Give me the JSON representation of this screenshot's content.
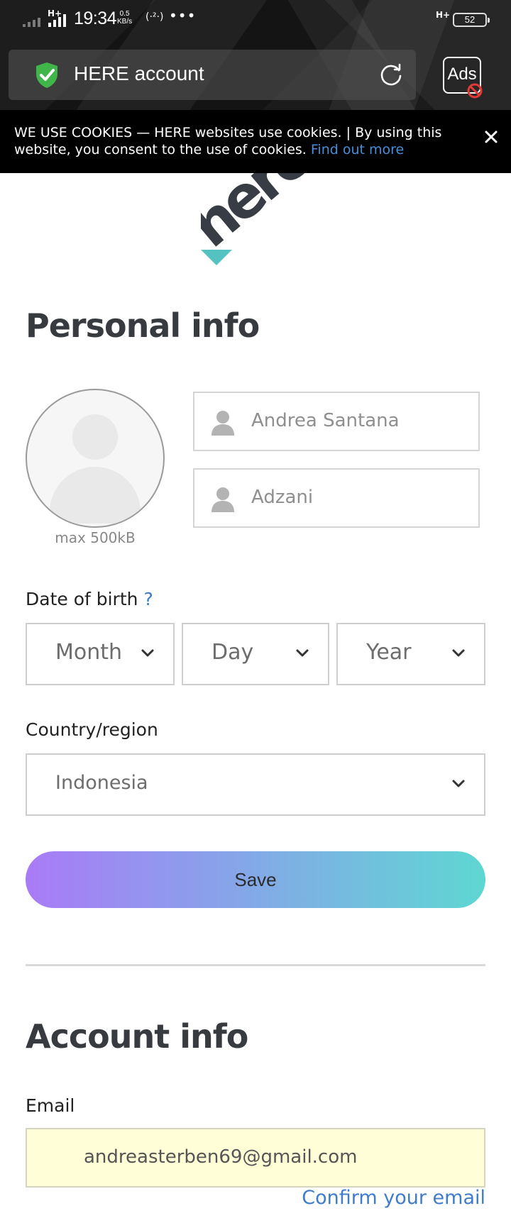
{
  "status_bar": {
    "network_left": "H+",
    "time": "19:34",
    "speed_value": "0.5",
    "speed_unit": "KB/s",
    "hotspot": "(·²·)",
    "more": "•••",
    "network_right": "H+",
    "battery": "52"
  },
  "browser": {
    "url_title": "HERE account",
    "ads_label": "Ads"
  },
  "cookie_banner": {
    "text": "WE USE COOKIES — HERE websites use cookies. | By using this website, you consent to the use of cookies.",
    "link": "Find out more"
  },
  "logo": {
    "text": "here"
  },
  "personal_info": {
    "title": "Personal info",
    "avatar_note": "max 500kB",
    "first_name": "Andrea Santana",
    "last_name": "Adzani",
    "dob_label": "Date of birth",
    "dob_help": "?",
    "month": "Month",
    "day": "Day",
    "year": "Year",
    "country_label": "Country/region",
    "country": "Indonesia",
    "save": "Save"
  },
  "account_info": {
    "title": "Account info",
    "email_label": "Email",
    "email": "andreasterben69@gmail.com",
    "confirm": "Confirm your email"
  },
  "colors": {
    "accent_link": "#3f7ccb",
    "shield_green": "#3fb54a",
    "logo_teal": "#55c2c2",
    "logo_dark": "#383c45",
    "save_gradient": [
      "#a97bf7",
      "#5ed7d2"
    ]
  }
}
